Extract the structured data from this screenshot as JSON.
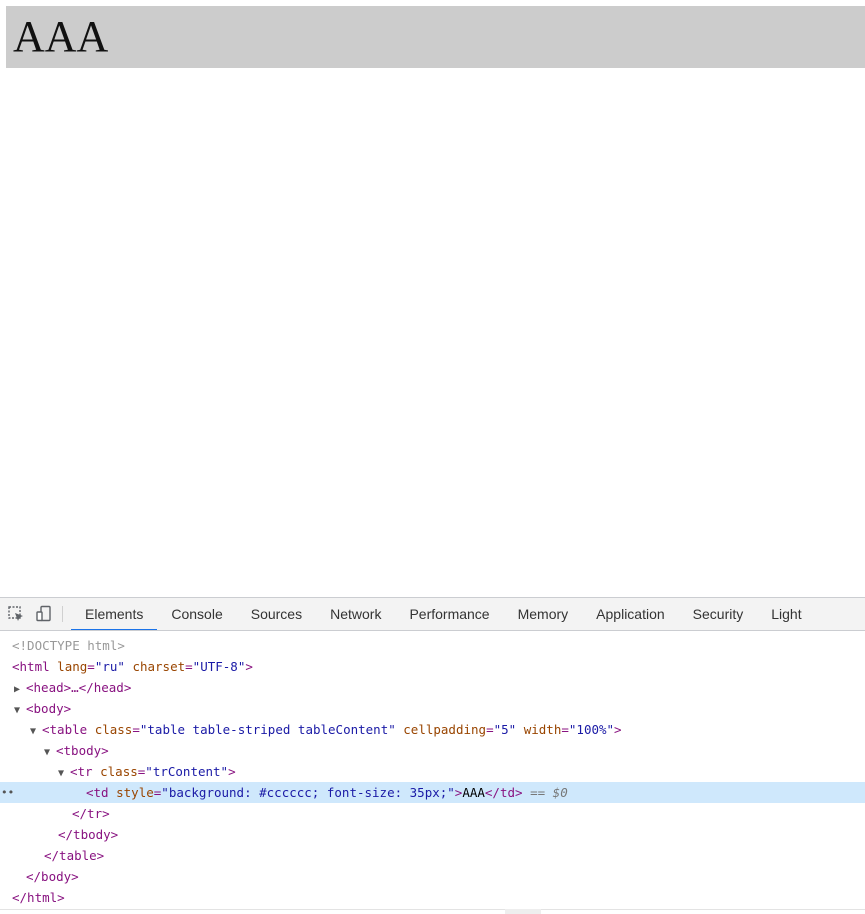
{
  "page": {
    "cell_text": "AAA",
    "cell_bg": "#cccccc"
  },
  "devtools": {
    "tabs": [
      "Elements",
      "Console",
      "Sources",
      "Network",
      "Performance",
      "Memory",
      "Application",
      "Security",
      "Light"
    ],
    "active_tab": "Elements",
    "accent": "#1a73e8",
    "dom": {
      "doctype": "<!DOCTYPE html>",
      "html_open_tag": "html",
      "html_attr1_name": "lang",
      "html_attr1_val": "\"ru\"",
      "html_attr2_name": "charset",
      "html_attr2_val": "\"UTF-8\"",
      "head_text": "<head>…</head>",
      "body_tag": "body",
      "table_tag": "table",
      "table_attr1_name": "class",
      "table_attr1_val": "\"table table-striped tableContent\"",
      "table_attr2_name": "cellpadding",
      "table_attr2_val": "\"5\"",
      "table_attr3_name": "width",
      "table_attr3_val": "\"100%\"",
      "tbody_tag": "tbody",
      "tr_tag": "tr",
      "tr_attr_name": "class",
      "tr_attr_val": "\"trContent\"",
      "td_tag": "td",
      "td_attr_name": "style",
      "td_attr_val": "\"background: #cccccc; font-size: 35px;\"",
      "td_text": "AAA",
      "selected_marker": "== $0",
      "close_tr": "</tr>",
      "close_tbody": "</tbody>",
      "close_table": "</table>",
      "close_body": "</body>",
      "close_html": "</html>"
    }
  }
}
